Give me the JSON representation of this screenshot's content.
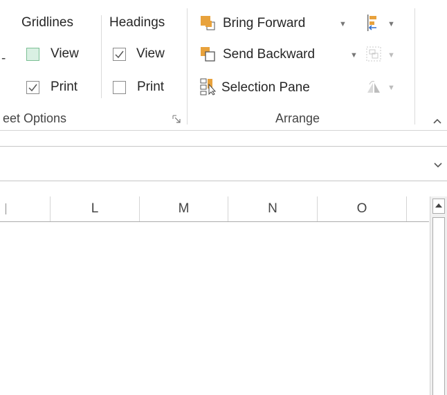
{
  "ribbon": {
    "sheet_options": {
      "gridlines_label": "Gridlines",
      "headings_label": "Headings",
      "gridlines_view_label": "View",
      "gridlines_view_checked": false,
      "gridlines_print_label": "Print",
      "gridlines_print_checked": true,
      "headings_view_label": "View",
      "headings_view_checked": true,
      "headings_print_label": "Print",
      "headings_print_checked": false,
      "group_label": "eet Options",
      "left_fragment": "-"
    },
    "arrange": {
      "bring_forward_label": "Bring Forward",
      "send_backward_label": "Send Backward",
      "selection_pane_label": "Selection Pane",
      "group_label": "Arrange",
      "align_icon": "align-icon",
      "group_icon": "group-icon",
      "rotate_icon": "rotate-icon"
    },
    "collapse_icon": "chevron-up-icon"
  },
  "formula_bar": {
    "expand_icon": "chevron-down-icon"
  },
  "grid": {
    "column_headers": [
      "L",
      "M",
      "N",
      "O"
    ],
    "partial_column_header": "",
    "scroll_up_icon": "scroll-up-arrow-icon"
  },
  "colors": {
    "bring_forward_orange": "#e8a23c",
    "send_backward_orange": "#e8a23c",
    "gridlines_view_highlight": "#d9f0e3",
    "align_blue": "#2f6fd0"
  }
}
